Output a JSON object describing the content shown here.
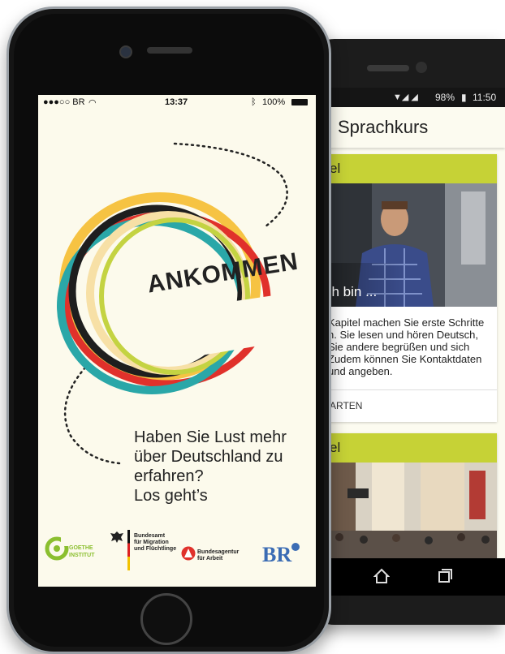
{
  "android": {
    "status": {
      "time": "11:50",
      "battery": "98%"
    },
    "appbar_title": "Sprachkurs",
    "cards": [
      {
        "header": "el",
        "image_caption": "ch bin ...",
        "description": [
          "Kapitel machen Sie erste Schritte",
          "n. Sie lesen und hören Deutsch,",
          "Sie andere begrüßen und sich",
          "Zudem können Sie Kontaktdaten",
          "und angeben."
        ],
        "button": "ARTEN"
      },
      {
        "header": "el"
      }
    ]
  },
  "iphone": {
    "status": {
      "carrier": "●●●○○ BR",
      "time": "13:37",
      "battery": "100%"
    },
    "logo_word": "ANKOMMEN",
    "headline_lines": [
      "Haben Sie Lust mehr",
      "über Deutschland zu",
      "erfahren?",
      "Los geht’s"
    ],
    "partners": {
      "goethe": [
        "GOETHE",
        "INSTITUT"
      ],
      "bamf": [
        "Bundesamt",
        "für Migration",
        "und Flüchtlinge"
      ],
      "ba": [
        "Bundesagentur",
        "für Arbeit"
      ],
      "br": "BR"
    }
  },
  "colors": {
    "accent_lime": "#c6d236",
    "ring_yellow": "#f6c343",
    "ring_red": "#e0312b",
    "ring_teal": "#2aa7a8",
    "ring_black": "#1e1e1e"
  }
}
